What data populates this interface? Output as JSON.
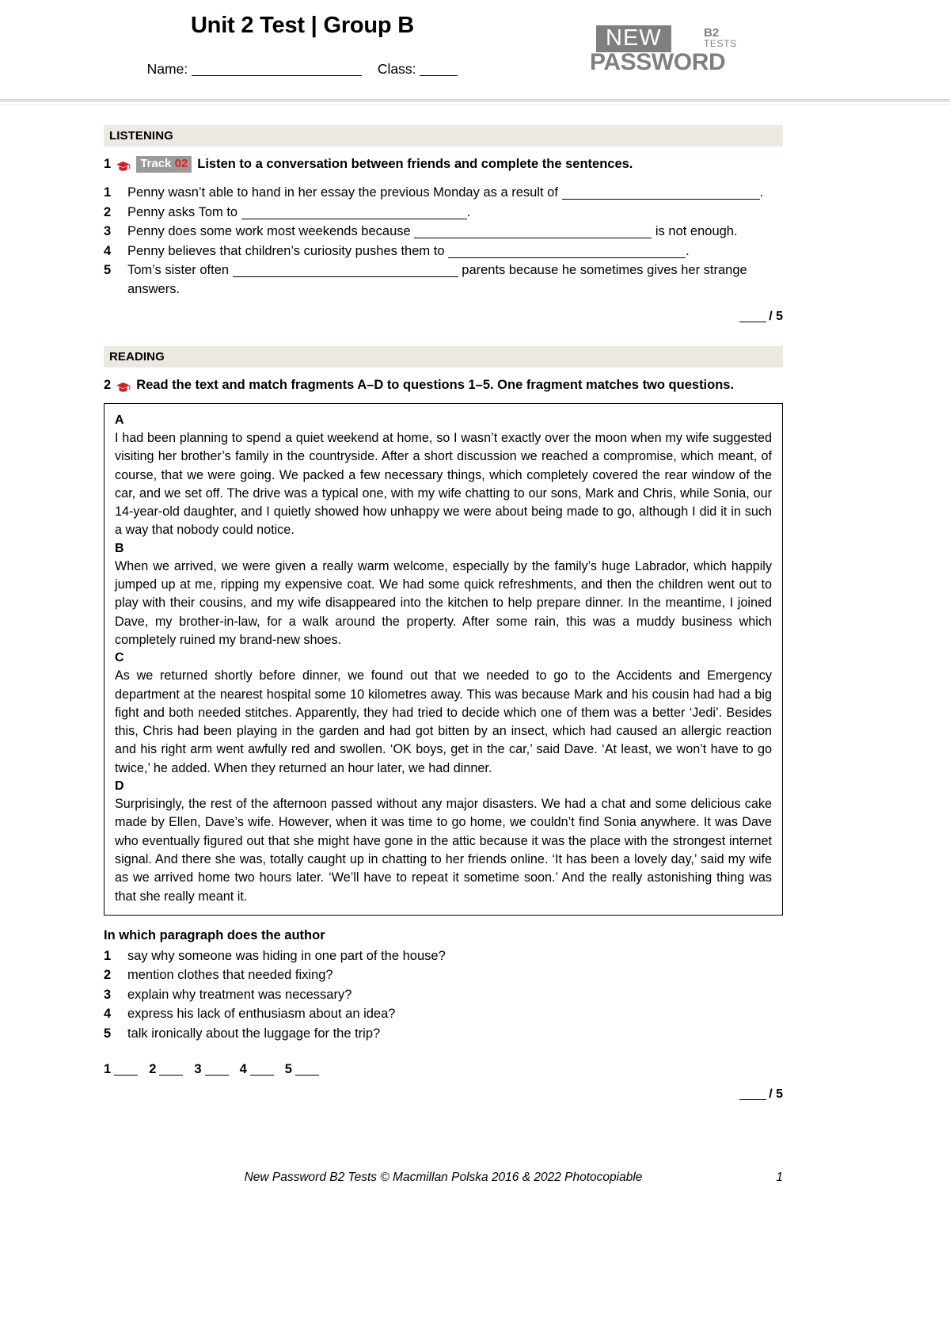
{
  "header": {
    "title": "Unit 2 Test | Group B",
    "name_label": "Name:",
    "class_label": "Class:",
    "logo": {
      "new": "NEW",
      "password": "PASSWORD",
      "level": "B2",
      "tests": "TESTS"
    }
  },
  "listening": {
    "section_label": "LISTENING",
    "task_number": "1",
    "track_word": "Track",
    "track_number": "02",
    "instruction": "Listen to a conversation between friends and complete the sentences.",
    "questions": [
      {
        "n": "1",
        "pre": "Penny wasn’t able to hand in her essay the previous Monday as a result of",
        "post": "."
      },
      {
        "n": "2",
        "pre": "Penny asks Tom to",
        "post": "."
      },
      {
        "n": "3",
        "pre": "Penny does some work most weekends because",
        "post": "is not enough."
      },
      {
        "n": "4",
        "pre": "Penny believes that children’s curiosity pushes them to",
        "post": "."
      },
      {
        "n": "5",
        "pre": "Tom’s sister often",
        "post": "parents because he sometimes gives her strange answers."
      }
    ],
    "score": "/ 5"
  },
  "reading": {
    "section_label": "READING",
    "task_number": "2",
    "instruction": "Read the text and match fragments A–D to questions 1–5. One fragment matches two questions.",
    "paragraphs": [
      {
        "label": "A",
        "text": "I had been planning to spend a quiet weekend at home, so I wasn’t exactly over the moon when my wife suggested visiting her brother’s family in the countryside. After a short discussion we reached a compromise, which meant, of course, that we were going. We packed a few necessary things, which completely covered the rear window of the car, and we set off. The drive was a typical one, with my wife chatting to our sons, Mark and Chris, while Sonia, our 14-year-old daughter, and I quietly showed how unhappy we were about being made to go, although I did it in such a way that nobody could notice."
      },
      {
        "label": "B",
        "text": "When we arrived, we were given a really warm welcome, especially by the family’s huge Labrador, which happily jumped up at me, ripping my expensive coat. We had some quick refreshments, and then the children went out to play with their cousins, and my wife disappeared into the kitchen to help prepare dinner. In the meantime, I joined Dave, my brother-in-law, for a walk around the property. After some rain, this was a muddy business which completely ruined my brand-new shoes."
      },
      {
        "label": "C",
        "text": "As we returned shortly before dinner, we found out that we needed to go to the Accidents and Emergency department at the nearest hospital some 10 kilometres away. This was because Mark and his cousin had had a big fight and both needed stitches. Apparently, they had tried to decide which one of them was a better ‘Jedi’. Besides this, Chris had been playing in the garden and had got bitten by an insect, which had caused an allergic reaction and his right arm went awfully red and swollen. ‘OK boys, get in the car,’ said Dave. ‘At least, we won’t have to go twice,’ he added. When they returned an hour later, we had dinner."
      },
      {
        "label": "D",
        "text": "Surprisingly, the rest of the afternoon passed without any major disasters. We had a chat and some delicious cake made by Ellen, Dave’s wife. However, when it was time to go home, we couldn’t find Sonia anywhere. It was Dave who eventually figured out that she might have gone in the attic because it was the place with the strongest internet signal. And there she was, totally caught up in chatting to her friends online. ‘It has been a lovely day,’ said my wife as we arrived home two hours later. ‘We’ll have to repeat it sometime soon.’ And the really astonishing thing was that she really meant it."
      }
    ],
    "subheading": "In which paragraph does the author",
    "questions": [
      {
        "n": "1",
        "text": "say why someone was hiding in one part of the house?"
      },
      {
        "n": "2",
        "text": "mention clothes that needed fixing?"
      },
      {
        "n": "3",
        "text": "explain why treatment was necessary?"
      },
      {
        "n": "4",
        "text": "express his lack of enthusiasm about an idea?"
      },
      {
        "n": "5",
        "text": "talk ironically about the luggage for the trip?"
      }
    ],
    "answer_slots": [
      "1",
      "2",
      "3",
      "4",
      "5"
    ],
    "score": "/ 5"
  },
  "footer": {
    "text": "New Password B2 Tests © Macmillan Polska 2016 & 2022 Photocopiable",
    "page": "1"
  },
  "colors": {
    "section_bar": "#ece9e0",
    "badge_bg": "#9a9a9a",
    "badge_num": "#e02020",
    "logo_grey": "#7f7f7f",
    "hat_red": "#cc2222"
  }
}
